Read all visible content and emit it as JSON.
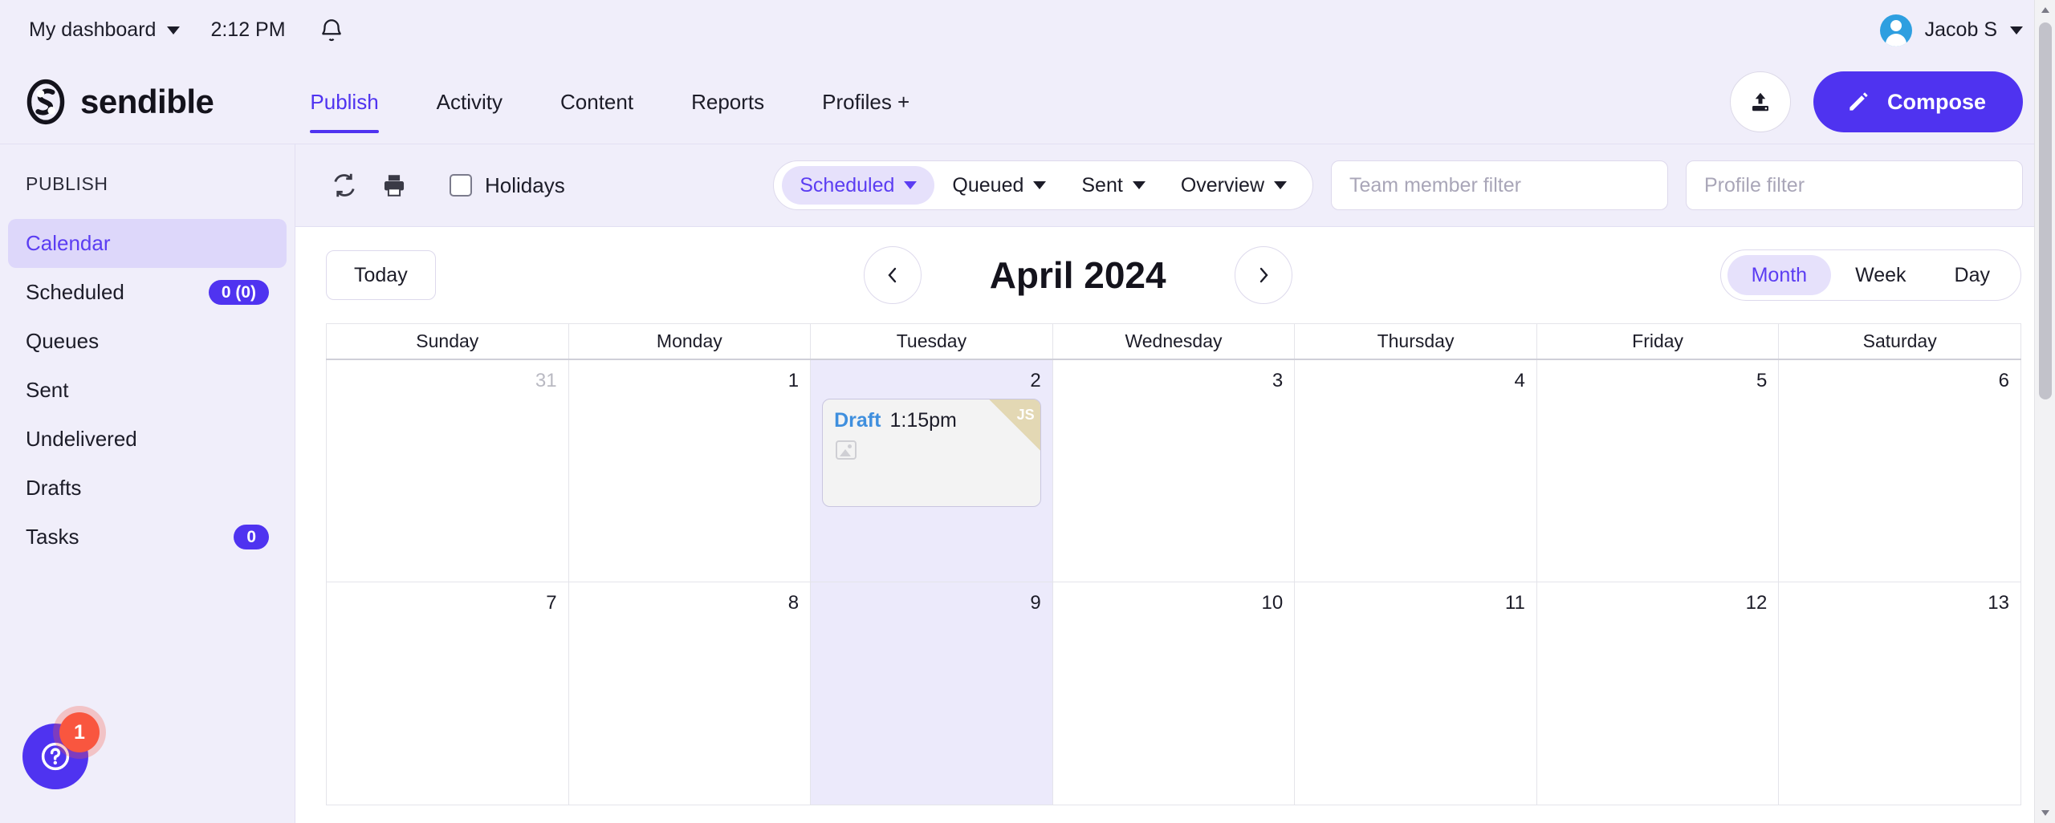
{
  "utility_bar": {
    "dashboard_label": "My dashboard",
    "time": "2:12 PM",
    "bell_icon": "bell-icon",
    "user_name": "Jacob S",
    "user_caret_icon": "chevron-down-icon"
  },
  "nav": {
    "logo_text": "sendible",
    "links": [
      {
        "label": "Publish",
        "active": true
      },
      {
        "label": "Activity",
        "active": false
      },
      {
        "label": "Content",
        "active": false
      },
      {
        "label": "Reports",
        "active": false
      },
      {
        "label": "Profiles +",
        "active": false
      }
    ],
    "upload_icon": "upload-icon",
    "compose_label": "Compose",
    "compose_icon": "pencil-icon"
  },
  "sidebar": {
    "title": "PUBLISH",
    "items": [
      {
        "label": "Calendar",
        "badge": "",
        "active": true
      },
      {
        "label": "Scheduled",
        "badge": "0 (0)",
        "active": false
      },
      {
        "label": "Queues",
        "badge": "",
        "active": false
      },
      {
        "label": "Sent",
        "badge": "",
        "active": false
      },
      {
        "label": "Undelivered",
        "badge": "",
        "active": false
      },
      {
        "label": "Drafts",
        "badge": "",
        "active": false
      },
      {
        "label": "Tasks",
        "badge": "0",
        "active": false
      }
    ],
    "help": {
      "icon": "question-mark-icon",
      "badge": "1"
    }
  },
  "toolbar": {
    "refresh_icon": "refresh-icon",
    "print_icon": "print-icon",
    "holidays_label": "Holidays",
    "holidays_checked": false,
    "filters": [
      {
        "label": "Scheduled",
        "active": true
      },
      {
        "label": "Queued",
        "active": false
      },
      {
        "label": "Sent",
        "active": false
      },
      {
        "label": "Overview",
        "active": false
      }
    ],
    "team_filter_placeholder": "Team member filter",
    "team_filter_value": "",
    "profile_filter_placeholder": "Profile filter",
    "profile_filter_value": ""
  },
  "calendar_header": {
    "today_label": "Today",
    "prev_icon": "chevron-left-icon",
    "next_icon": "chevron-right-icon",
    "month_title": "April 2024",
    "views": [
      {
        "label": "Month",
        "active": true
      },
      {
        "label": "Week",
        "active": false
      },
      {
        "label": "Day",
        "active": false
      }
    ]
  },
  "calendar": {
    "day_headers": [
      "Sunday",
      "Monday",
      "Tuesday",
      "Wednesday",
      "Thursday",
      "Friday",
      "Saturday"
    ],
    "today_column_index": 2,
    "weeks": [
      {
        "days": [
          {
            "num": "31",
            "muted": true,
            "events": []
          },
          {
            "num": "1",
            "muted": false,
            "events": []
          },
          {
            "num": "2",
            "muted": false,
            "events": [
              {
                "status": "Draft",
                "time": "1:15pm",
                "initials": "JS",
                "media_icon": "broken-image-icon"
              }
            ]
          },
          {
            "num": "3",
            "muted": false,
            "events": []
          },
          {
            "num": "4",
            "muted": false,
            "events": []
          },
          {
            "num": "5",
            "muted": false,
            "events": []
          },
          {
            "num": "6",
            "muted": false,
            "events": []
          }
        ]
      },
      {
        "days": [
          {
            "num": "7",
            "muted": false,
            "events": []
          },
          {
            "num": "8",
            "muted": false,
            "events": []
          },
          {
            "num": "9",
            "muted": false,
            "events": []
          },
          {
            "num": "10",
            "muted": false,
            "events": []
          },
          {
            "num": "11",
            "muted": false,
            "events": []
          },
          {
            "num": "12",
            "muted": false,
            "events": []
          },
          {
            "num": "13",
            "muted": false,
            "events": []
          }
        ]
      }
    ]
  },
  "colors": {
    "accent": "#4f33f0",
    "accent_soft": "#e6e1fb",
    "page_bg": "#f0eefa",
    "badge_red": "#f9563f",
    "draft_blue": "#3f8fde",
    "ribbon": "#e3d8b4"
  }
}
